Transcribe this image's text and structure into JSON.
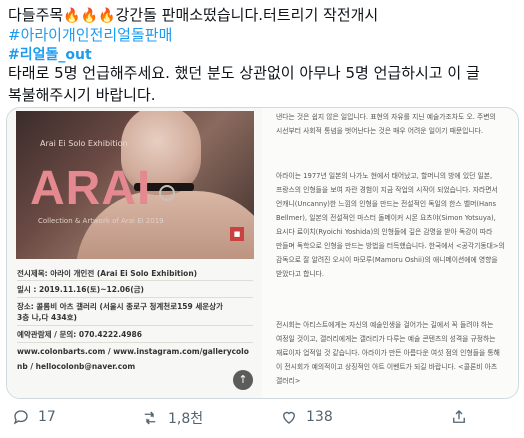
{
  "tweet": {
    "line1_pre": "다들주목",
    "line1_post": "강간돌 판매소떴습니다.터트리기 작전개시",
    "fire_glyph": "🔥",
    "hashtag": "#아라이개인전리얼돌판매",
    "mention": "#리얼돌_out",
    "line4": "타래로 5명 언급해주세요. 했던 분도 상관없이 아무나 5명 언급하시고 이 글",
    "line5": "복불해주시기 바랍니다."
  },
  "poster": {
    "subtitle": "Arai Ei Solo Exhibition",
    "title": "ARAI",
    "foot": "Collection & Artwork of Arai Ei 2019",
    "info": {
      "exhibit": "전시제목: 아라이 개인전 (Arai Ei Solo Exhibition)",
      "dates": "일시 : 2019.11.16(토)~12.06(금)",
      "place1": "장소: 콜롬비 아츠 갤러리 (서울시 종로구 청계천로159 세운상가",
      "place2": "3층 나,다 434호)",
      "contact": "예약관람제 / 문의: 070.4222.4986",
      "web1": "www.colonbarts.com / www.instagram.com/gallerycolo",
      "web2": "nb / hellocolonb@naver.com"
    }
  },
  "description": {
    "p1": "낸다는 것은 쉽지 않은 일입니다. 표현의 자유를 지닌 예술가조차도 오. 주변의 시선부터 사회적 통념을 벗어난다는 것은 매우 어려운 일이기 때문입니다.",
    "p2": "아라이는 1977년 일본의 나가노 현에서 태어났고, 할머니의 방에 있던 일본, 프랑스의 인형들을 보여 자란 경험이 지금 작업의 시작이 되었습니다. 자라면서 언캐니(Uncanny)한 느낌의 인형을 만드는 전설적인 독일의 한스 벨머(Hans Bellmer), 일본의 전설적인 마스터 돌메이커 시몬 요츠야(Simon Yotsuya), 요시다 료이치(Ryoichi Yoshida)의 인형들에 깊은 감명을 받아 독강이 따라 만들며 독학으로 인형을 만드는 방법을 터득했습니다. 한국에서 <공각기동대>의 감독으로 잘 알려진 오시이 마모루(Mamoru Oshii)의 애니메이션에에 영향을 받았다고 합니다.",
    "p3": "전시회는 아티스트에게는 자신의 예술인생을 걸어가는 길에서 꼭 들려야 하는 여정일 것이고, 갤러리에게는 갤러리가 다루는 예술 콘텐츠의 성격을 규정하는 재료이자 업적일 것 같습니다. 아라이가 만든 아름다운 여섯 점의 인형들을 통해 이 전시회가 예의적이고 상징적인 아트 이벤트가 되길 바랍니다. <콜론비 아츠 갤러리>"
  },
  "actions": {
    "reply_count": "17",
    "retweet_count": "1,8천",
    "like_count": "138"
  }
}
